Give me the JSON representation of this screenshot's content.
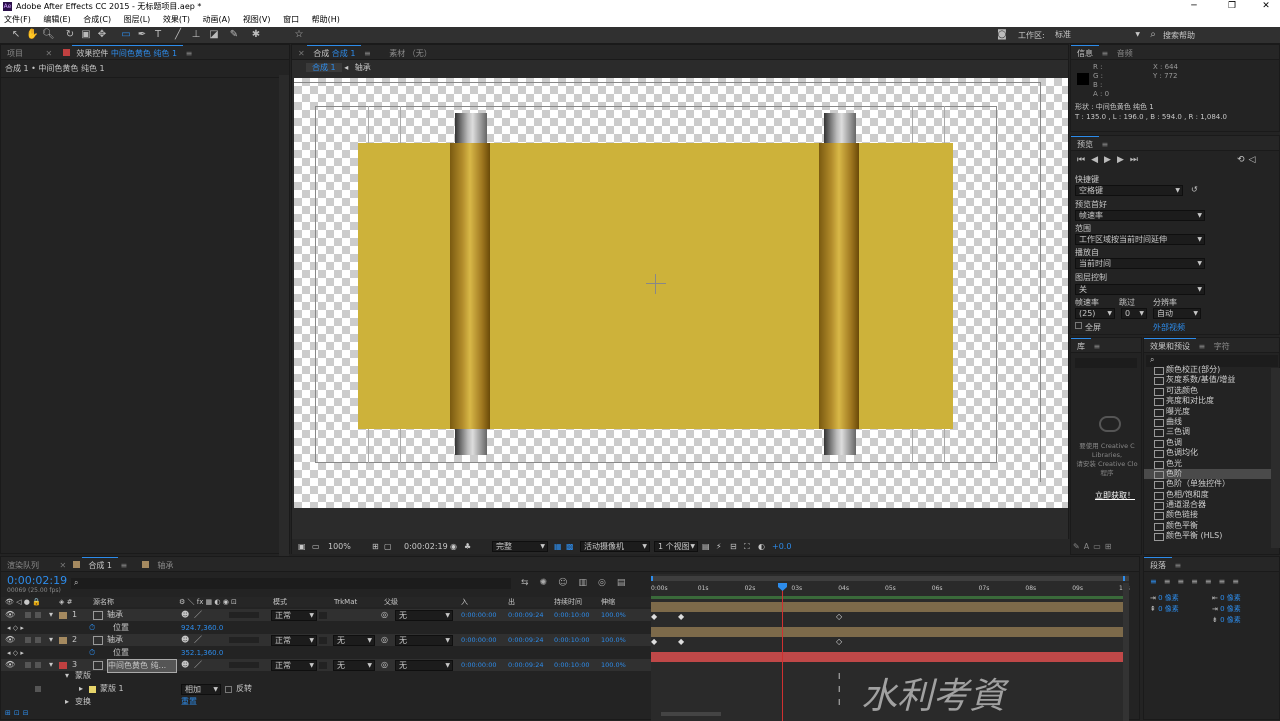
{
  "titlebar": {
    "title": "Adobe After Effects CC 2015 - 无标题项目.aep *",
    "minimize": "─",
    "maximize": "❐",
    "close": "✕"
  },
  "menu": [
    "文件(F)",
    "编辑(E)",
    "合成(C)",
    "图层(L)",
    "效果(T)",
    "动画(A)",
    "视图(V)",
    "窗口",
    "帮助(H)"
  ],
  "toolbar": {
    "workspace_label": "工作区:",
    "workspace_value": "标准",
    "search_placeholder": "搜索帮助"
  },
  "left_panel": {
    "tab_project": "项目",
    "tab_effects": "效果控件",
    "tab_effects_layer": "中间色黄色 纯色 1",
    "breadcrumb": "合成 1 • 中间色黄色 纯色 1"
  },
  "comp_panel": {
    "tab_comp": "合成",
    "tab_comp_name": "合成 1",
    "tab_footage": "素材 （无）",
    "crumb_comp": "合成 1",
    "crumb_layer": "轴承",
    "zoom": "100%",
    "timecode": "0:00:02:19",
    "quality": "完整",
    "camera": "活动摄像机",
    "views": "1 个视图",
    "exposure": "+0.0"
  },
  "info_panel": {
    "tab_info": "信息",
    "tab_audio": "音频",
    "r": "R :",
    "g": "G :",
    "b": "B :",
    "a": "A : 0",
    "x": "X : 644",
    "y": "Y : 772",
    "shape": "形状 : 中间色黄色 纯色 1",
    "bounds": "T : 135.0 , L : 196.0 , B : 594.0 , R : 1,084.0"
  },
  "preview_panel": {
    "title": "预览",
    "shortcut_label": "快捷键",
    "shortcut_value": "空格键",
    "pref_label": "预览首好",
    "pref_value": "帧速率",
    "range_label": "范围",
    "range_value": "工作区域按当前时间延伸",
    "play_from_label": "播放自",
    "play_from_value": "当前时间",
    "frame_ctrl_label": "图层控制",
    "frame_ctrl_value": "关",
    "fps_label": "帧速率",
    "fps_value": "(25)",
    "skip_label": "跳过",
    "skip_value": "0",
    "res_label": "分辨率",
    "res_value": "自动",
    "fullscreen": "全屏",
    "external": "外部视频"
  },
  "library_panel": {
    "tab": "库",
    "msg1": "要使用 Creative C",
    "msg2": "Libraries,",
    "msg3": "请安装 Creative Clo",
    "msg4": "程序",
    "link": "立即获取！"
  },
  "effects_panel": {
    "tab": "效果和预设",
    "tab2": "字符",
    "items": [
      "颜色校正(部分)",
      "灰度系数/基值/增益",
      "可选颜色",
      "亮度和对比度",
      "曝光度",
      "曲线",
      "三色调",
      "色调",
      "色调均化",
      "色光",
      "色阶",
      "色阶（单独控件）",
      "色相/饱和度",
      "通道混合器",
      "颜色链接",
      "颜色平衡",
      "颜色平衡 (HLS)"
    ],
    "selected_index": 10
  },
  "timeline": {
    "tab_render": "渲染队列",
    "tab_comp": "合成 1",
    "tab_layer": "轴承",
    "timecode": "0:00:02:19",
    "fps": "00069 (25.00 fps)",
    "headers": {
      "name": "源名称",
      "mode": "模式",
      "trkmat": "TrkMat",
      "parent": "父级",
      "in": "入",
      "out": "出",
      "duration": "持续时间",
      "stretch": "伸缩"
    },
    "ruler": [
      "0:00s",
      "01s",
      "02s",
      "03s",
      "04s",
      "05s",
      "06s",
      "07s",
      "08s",
      "09s",
      "10s"
    ],
    "layers": [
      {
        "num": "1",
        "name": "轴承",
        "mode": "正常",
        "trkmat": "",
        "parent": "无",
        "in": "0:00:00:00",
        "out": "0:00:09:24",
        "dur": "0:00:10:00",
        "stretch": "100.0%",
        "color": "#a58a60",
        "pos_label": "位置",
        "pos_value": "924.7,360.0"
      },
      {
        "num": "2",
        "name": "轴承",
        "mode": "正常",
        "trkmat": "无",
        "parent": "无",
        "in": "0:00:00:00",
        "out": "0:00:09:24",
        "dur": "0:00:10:00",
        "stretch": "100.0%",
        "color": "#a58a60",
        "pos_label": "位置",
        "pos_value": "352.1,360.0"
      },
      {
        "num": "3",
        "name": "中间色黄色 纯...",
        "mode": "正常",
        "trkmat": "无",
        "parent": "无",
        "in": "0:00:00:00",
        "out": "0:00:09:24",
        "dur": "0:00:10:00",
        "stretch": "100.0%",
        "color": "#c04040"
      }
    ],
    "mask_group": "蒙版",
    "mask_name": "蒙版 1",
    "mask_mode": "相加",
    "mask_invert": "反转",
    "transform": "变换",
    "reset": "重置"
  },
  "paragraph_panel": {
    "tab": "段落",
    "px1": "0 像素",
    "px2": "0 像素",
    "px3": "0 像素",
    "px4": "0 像素",
    "px5": "0 像素"
  },
  "watermark": "水利考資"
}
